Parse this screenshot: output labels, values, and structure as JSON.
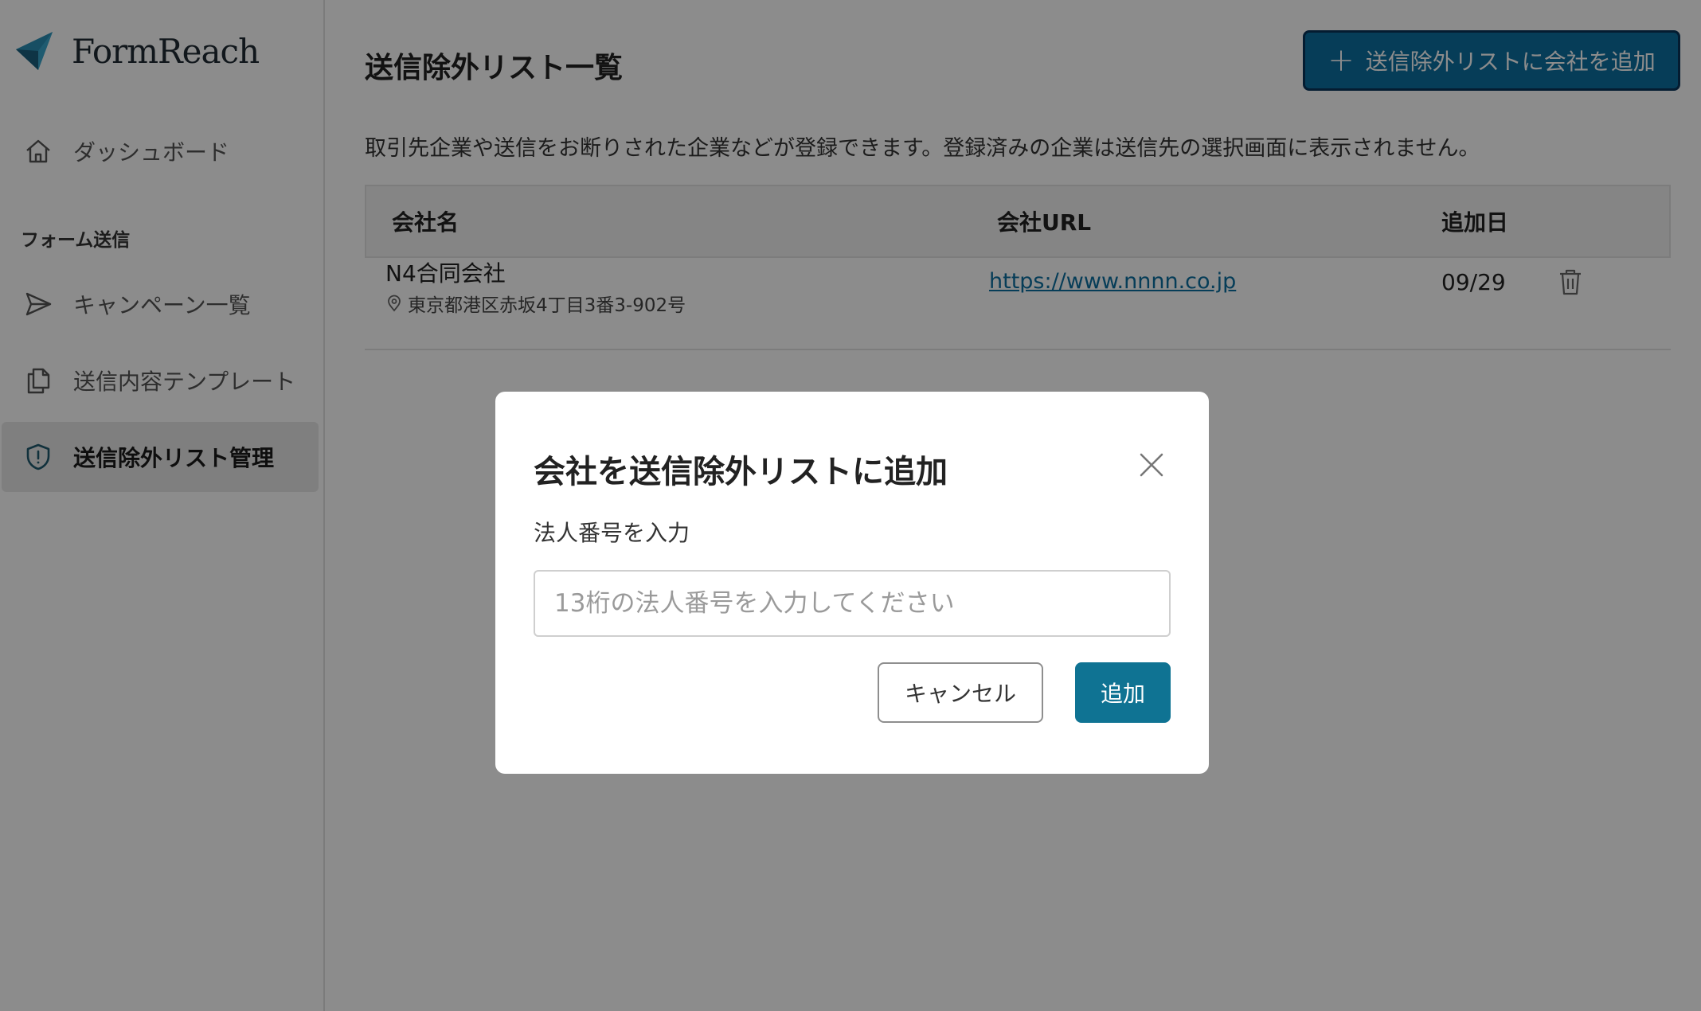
{
  "app": {
    "name": "FormReach"
  },
  "sidebar": {
    "items": [
      {
        "label": "ダッシュボード",
        "icon": "home-icon"
      },
      {
        "label": "キャンペーン一覧",
        "icon": "send-icon"
      },
      {
        "label": "送信内容テンプレート",
        "icon": "copy-icon"
      },
      {
        "label": "送信除外リスト管理",
        "icon": "shield-icon",
        "active": true
      }
    ],
    "section_label": "フォーム送信"
  },
  "main": {
    "title": "送信除外リスト一覧",
    "add_button_label": "送信除外リストに会社を追加",
    "description": "取引先企業や送信をお断りされた企業などが登録できます。登録済みの企業は送信先の選択画面に表示されません。",
    "table": {
      "headers": {
        "name": "会社名",
        "url": "会社URL",
        "date": "追加日"
      },
      "rows": [
        {
          "name": "N4合同会社",
          "address": "東京都港区赤坂4丁目3番3-902号",
          "url": "https://www.nnnn.co.jp",
          "date": "09/29"
        }
      ]
    }
  },
  "modal": {
    "title": "会社を送信除外リストに追加",
    "field_label": "法人番号を入力",
    "input_placeholder": "13桁の法人番号を入力してください",
    "input_value": "",
    "cancel_label": "キャンセル",
    "submit_label": "追加"
  },
  "colors": {
    "primary": "#0f7393",
    "overlay": "rgba(0,0,0,0.45)",
    "link": "#0b6fa1"
  }
}
